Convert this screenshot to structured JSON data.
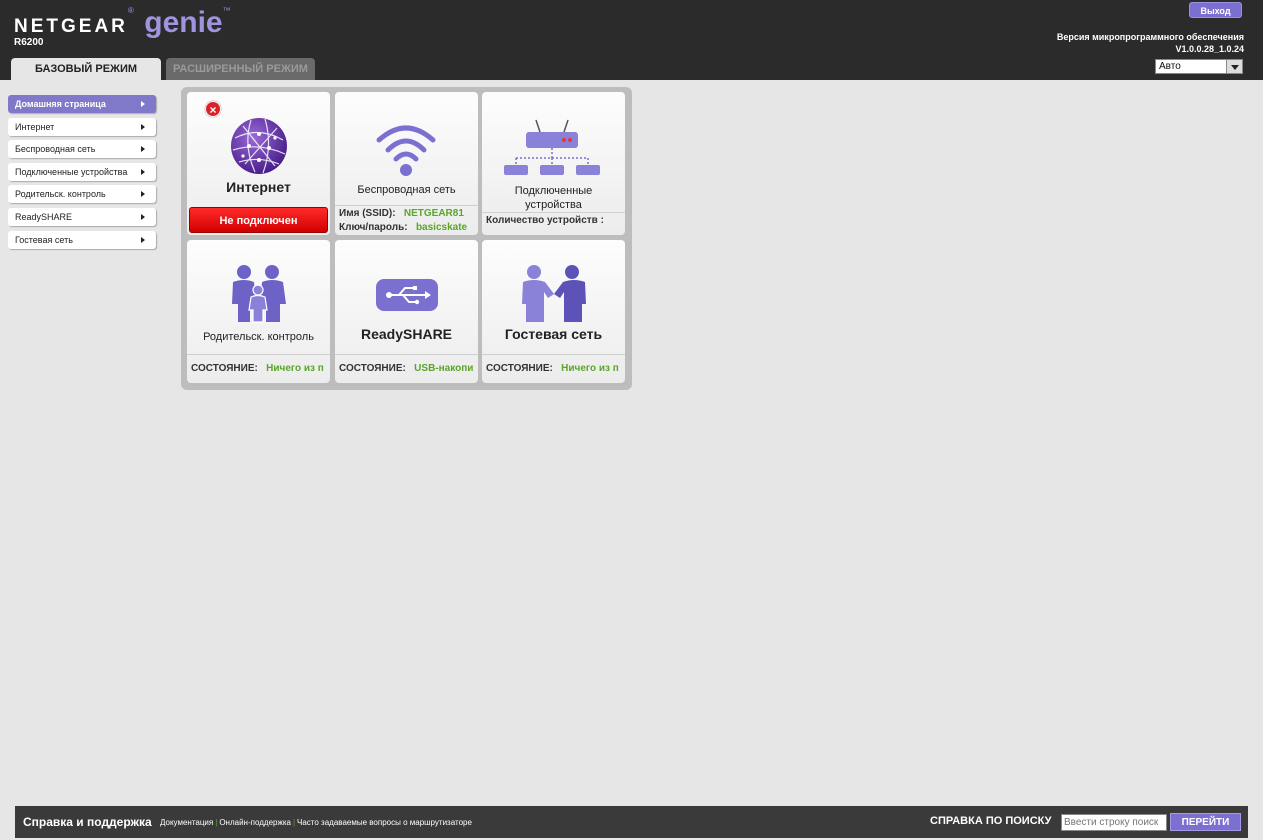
{
  "header": {
    "brand": "NETGEAR",
    "product": "genie",
    "model": "R6200",
    "logout_label": "Выход",
    "firmware_label": "Версия микропрограммного обеспечения",
    "firmware_version": "V1.0.0.28_1.0.24",
    "language_value": "Авто"
  },
  "tabs": {
    "basic": "БАЗОВЫЙ РЕЖИМ",
    "advanced": "РАСШИРЕННЫЙ РЕЖИМ"
  },
  "sidebar": {
    "items": [
      {
        "label": "Домашняя страница",
        "active": true
      },
      {
        "label": "Интернет"
      },
      {
        "label": "Беспроводная сеть"
      },
      {
        "label": "Подключенные устройства"
      },
      {
        "label": "Родительск. контроль"
      },
      {
        "label": "ReadySHARE"
      },
      {
        "label": "Гостевая сеть"
      }
    ]
  },
  "tiles": {
    "internet": {
      "title": "Интернет",
      "status": "Не подключен",
      "icon": "globe-icon"
    },
    "wireless": {
      "title": "Беспроводная сеть",
      "ssid_label": "Имя (SSID):",
      "ssid_value": "NETGEAR81",
      "key_label": "Ключ/пароль:",
      "key_value": "basicskate",
      "icon": "wifi-icon"
    },
    "devices": {
      "title_line1": "Подключенные",
      "title_line2": "устройства",
      "count_label": "Количество устройств :",
      "icon": "network-icon"
    },
    "parental": {
      "title": "Родительск. контроль",
      "status_label": "СОСТОЯНИЕ:",
      "status_value": "Ничего из п",
      "icon": "family-icon"
    },
    "readyshare": {
      "title": "ReadySHARE",
      "status_label": "СОСТОЯНИЕ:",
      "status_value": "USB-накопи",
      "icon": "usb-icon"
    },
    "guest": {
      "title": "Гостевая сеть",
      "status_label": "СОСТОЯНИЕ:",
      "status_value": "Ничего из п",
      "icon": "handshake-icon"
    }
  },
  "footer": {
    "help_title": "Справка и поддержка",
    "links": [
      "Документация",
      "Онлайн-поддержка",
      "Часто задаваемые вопросы о маршрутизаторе"
    ],
    "search_label": "СПРАВКА ПО ПОИСКУ",
    "search_placeholder": "Ввести строку поиск",
    "go_label": "ПЕРЕЙТИ"
  },
  "colors": {
    "accent": "#7b6fd0",
    "status_error": "#e00000",
    "status_ok_text": "#5aa52a"
  }
}
